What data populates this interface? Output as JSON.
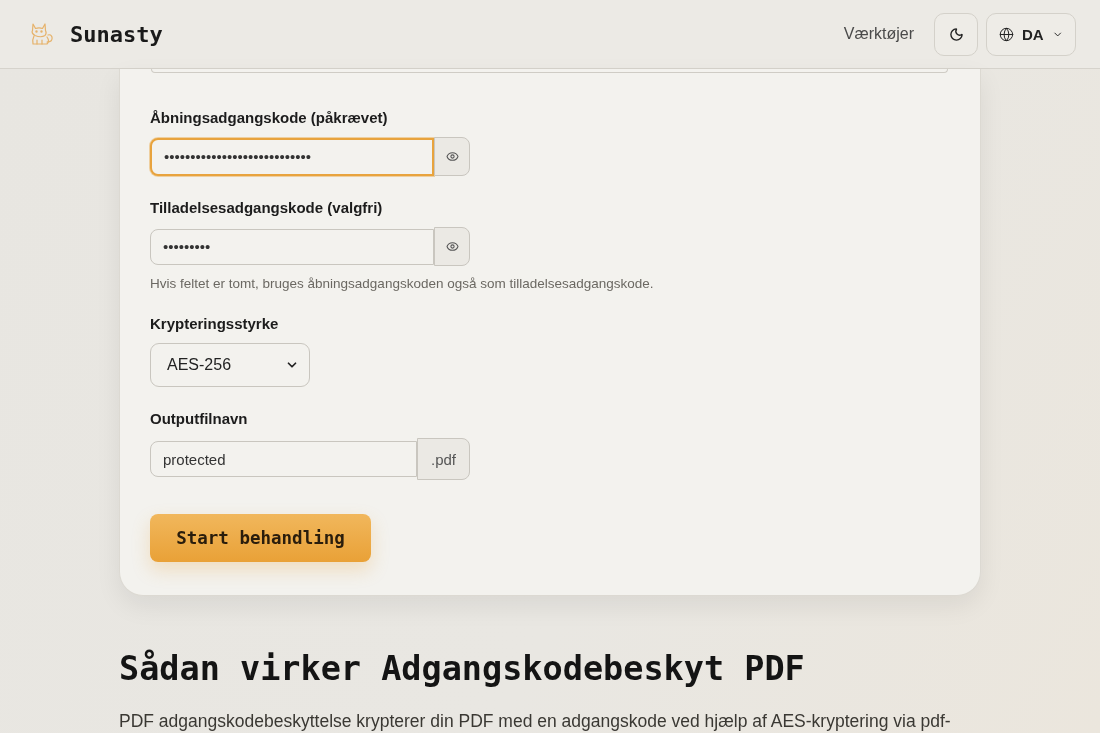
{
  "header": {
    "brand": "Sunasty",
    "nav_link": "Værktøjer",
    "language": "DA"
  },
  "form": {
    "fields": [
      {
        "kind": "password",
        "label": "Åbningsadgangskode (påkrævet)",
        "value": "••••••••••••••••••••••••••••",
        "focused": true
      },
      {
        "kind": "password",
        "label": "Tilladelsesadgangskode (valgfri)",
        "value": "•••••••••",
        "focused": false,
        "hint": "Hvis feltet er tomt, bruges åbningsadgangskoden også som tilladelsesadgangskode."
      },
      {
        "kind": "select",
        "label": "Krypteringsstyrke",
        "value": "AES-256"
      },
      {
        "kind": "suffix",
        "label": "Outputfilnavn",
        "value": "protected",
        "suffix": ".pdf"
      }
    ],
    "submit": "Start behandling"
  },
  "section": {
    "heading": "Sådan virker Adgangskodebeskyt PDF",
    "paragraph": "PDF adgangskodebeskyttelse krypterer din PDF med en adgangskode ved hjælp af AES-kryptering via pdf-"
  }
}
